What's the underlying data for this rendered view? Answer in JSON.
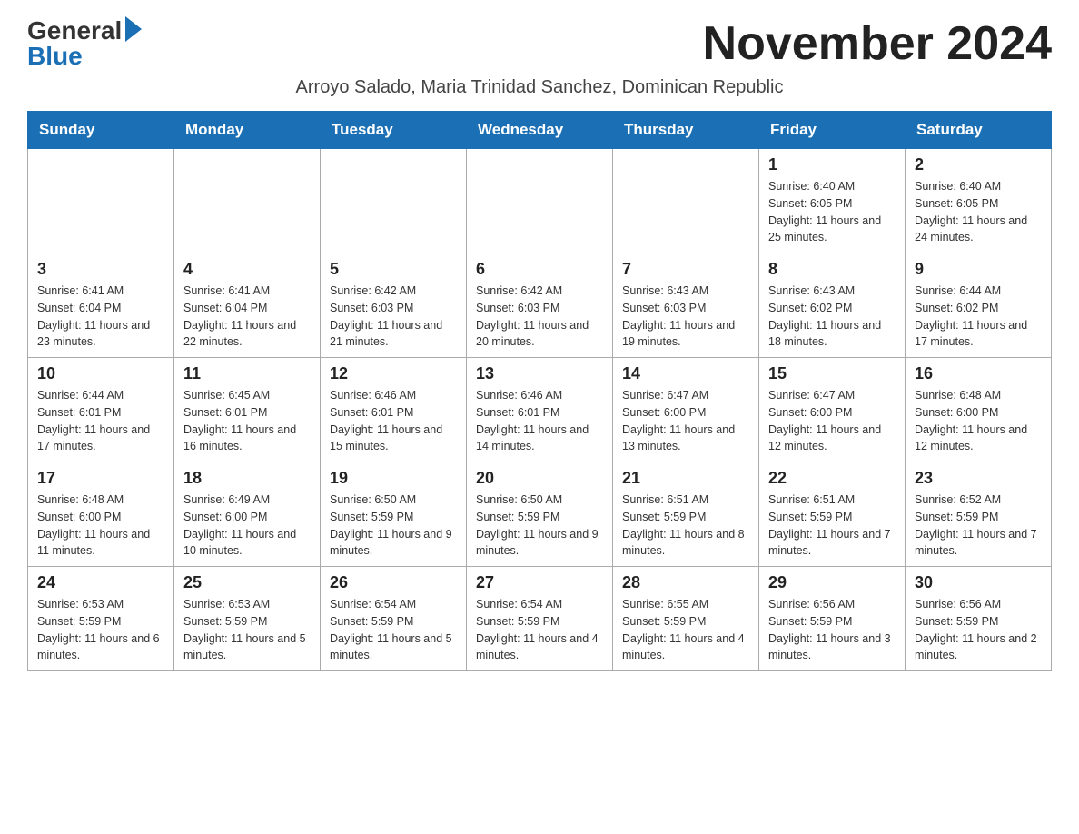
{
  "logo": {
    "general": "General",
    "blue": "Blue",
    "line_separator": "—"
  },
  "header": {
    "title": "November 2024",
    "subtitle": "Arroyo Salado, Maria Trinidad Sanchez, Dominican Republic"
  },
  "columns": [
    "Sunday",
    "Monday",
    "Tuesday",
    "Wednesday",
    "Thursday",
    "Friday",
    "Saturday"
  ],
  "weeks": [
    [
      {
        "day": "",
        "info": ""
      },
      {
        "day": "",
        "info": ""
      },
      {
        "day": "",
        "info": ""
      },
      {
        "day": "",
        "info": ""
      },
      {
        "day": "",
        "info": ""
      },
      {
        "day": "1",
        "info": "Sunrise: 6:40 AM\nSunset: 6:05 PM\nDaylight: 11 hours and 25 minutes."
      },
      {
        "day": "2",
        "info": "Sunrise: 6:40 AM\nSunset: 6:05 PM\nDaylight: 11 hours and 24 minutes."
      }
    ],
    [
      {
        "day": "3",
        "info": "Sunrise: 6:41 AM\nSunset: 6:04 PM\nDaylight: 11 hours and 23 minutes."
      },
      {
        "day": "4",
        "info": "Sunrise: 6:41 AM\nSunset: 6:04 PM\nDaylight: 11 hours and 22 minutes."
      },
      {
        "day": "5",
        "info": "Sunrise: 6:42 AM\nSunset: 6:03 PM\nDaylight: 11 hours and 21 minutes."
      },
      {
        "day": "6",
        "info": "Sunrise: 6:42 AM\nSunset: 6:03 PM\nDaylight: 11 hours and 20 minutes."
      },
      {
        "day": "7",
        "info": "Sunrise: 6:43 AM\nSunset: 6:03 PM\nDaylight: 11 hours and 19 minutes."
      },
      {
        "day": "8",
        "info": "Sunrise: 6:43 AM\nSunset: 6:02 PM\nDaylight: 11 hours and 18 minutes."
      },
      {
        "day": "9",
        "info": "Sunrise: 6:44 AM\nSunset: 6:02 PM\nDaylight: 11 hours and 17 minutes."
      }
    ],
    [
      {
        "day": "10",
        "info": "Sunrise: 6:44 AM\nSunset: 6:01 PM\nDaylight: 11 hours and 17 minutes."
      },
      {
        "day": "11",
        "info": "Sunrise: 6:45 AM\nSunset: 6:01 PM\nDaylight: 11 hours and 16 minutes."
      },
      {
        "day": "12",
        "info": "Sunrise: 6:46 AM\nSunset: 6:01 PM\nDaylight: 11 hours and 15 minutes."
      },
      {
        "day": "13",
        "info": "Sunrise: 6:46 AM\nSunset: 6:01 PM\nDaylight: 11 hours and 14 minutes."
      },
      {
        "day": "14",
        "info": "Sunrise: 6:47 AM\nSunset: 6:00 PM\nDaylight: 11 hours and 13 minutes."
      },
      {
        "day": "15",
        "info": "Sunrise: 6:47 AM\nSunset: 6:00 PM\nDaylight: 11 hours and 12 minutes."
      },
      {
        "day": "16",
        "info": "Sunrise: 6:48 AM\nSunset: 6:00 PM\nDaylight: 11 hours and 12 minutes."
      }
    ],
    [
      {
        "day": "17",
        "info": "Sunrise: 6:48 AM\nSunset: 6:00 PM\nDaylight: 11 hours and 11 minutes."
      },
      {
        "day": "18",
        "info": "Sunrise: 6:49 AM\nSunset: 6:00 PM\nDaylight: 11 hours and 10 minutes."
      },
      {
        "day": "19",
        "info": "Sunrise: 6:50 AM\nSunset: 5:59 PM\nDaylight: 11 hours and 9 minutes."
      },
      {
        "day": "20",
        "info": "Sunrise: 6:50 AM\nSunset: 5:59 PM\nDaylight: 11 hours and 9 minutes."
      },
      {
        "day": "21",
        "info": "Sunrise: 6:51 AM\nSunset: 5:59 PM\nDaylight: 11 hours and 8 minutes."
      },
      {
        "day": "22",
        "info": "Sunrise: 6:51 AM\nSunset: 5:59 PM\nDaylight: 11 hours and 7 minutes."
      },
      {
        "day": "23",
        "info": "Sunrise: 6:52 AM\nSunset: 5:59 PM\nDaylight: 11 hours and 7 minutes."
      }
    ],
    [
      {
        "day": "24",
        "info": "Sunrise: 6:53 AM\nSunset: 5:59 PM\nDaylight: 11 hours and 6 minutes."
      },
      {
        "day": "25",
        "info": "Sunrise: 6:53 AM\nSunset: 5:59 PM\nDaylight: 11 hours and 5 minutes."
      },
      {
        "day": "26",
        "info": "Sunrise: 6:54 AM\nSunset: 5:59 PM\nDaylight: 11 hours and 5 minutes."
      },
      {
        "day": "27",
        "info": "Sunrise: 6:54 AM\nSunset: 5:59 PM\nDaylight: 11 hours and 4 minutes."
      },
      {
        "day": "28",
        "info": "Sunrise: 6:55 AM\nSunset: 5:59 PM\nDaylight: 11 hours and 4 minutes."
      },
      {
        "day": "29",
        "info": "Sunrise: 6:56 AM\nSunset: 5:59 PM\nDaylight: 11 hours and 3 minutes."
      },
      {
        "day": "30",
        "info": "Sunrise: 6:56 AM\nSunset: 5:59 PM\nDaylight: 11 hours and 2 minutes."
      }
    ]
  ]
}
